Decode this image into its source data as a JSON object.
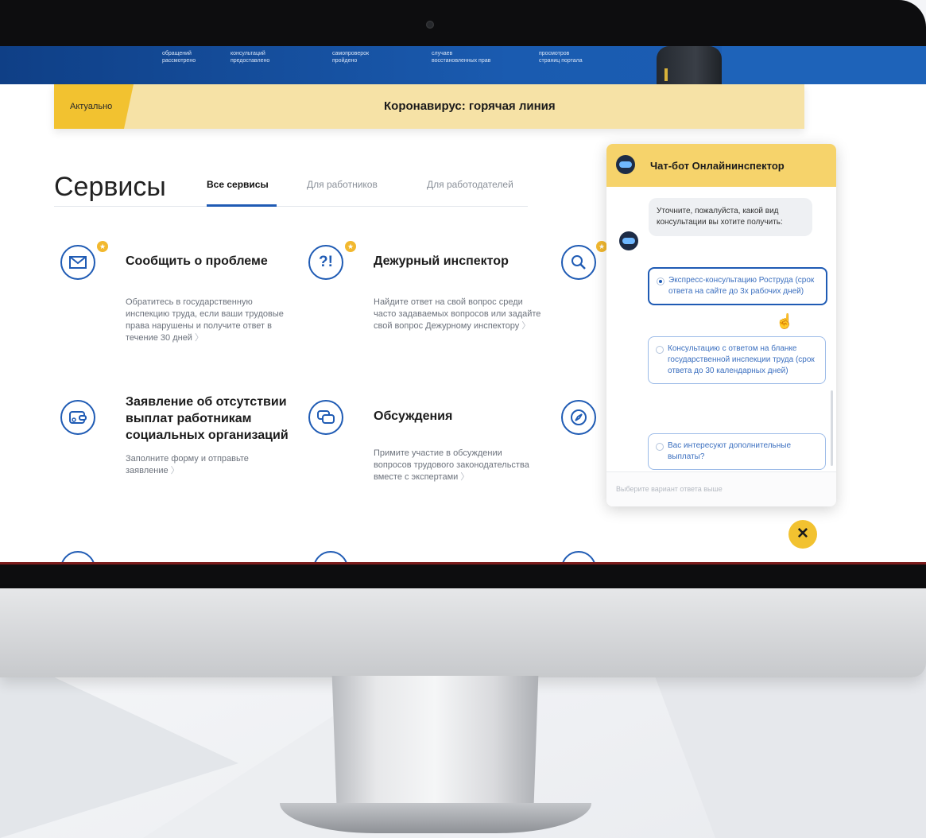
{
  "hero": {
    "stats": [
      {
        "line1": "обращений",
        "line2": "рассмотрено"
      },
      {
        "line1": "консультаций",
        "line2": "предоставлено"
      },
      {
        "line1": "самопроверок",
        "line2": "пройдено"
      },
      {
        "line1": "случаев",
        "line2": "восстановленных прав"
      },
      {
        "line1": "просмотров",
        "line2": "страниц портала"
      }
    ]
  },
  "banner": {
    "tag": "Актуально",
    "title": "Коронавирус: горячая линия"
  },
  "services": {
    "title": "Сервисы",
    "tabs": [
      {
        "label": "Все сервисы"
      },
      {
        "label": "Для работников"
      },
      {
        "label": "Для работодателей"
      }
    ],
    "items": [
      {
        "title": "Сообщить о проблеме",
        "description": "Обратитесь в государственную инспекцию труда, если ваши трудовые права нарушены и получите ответ в течение 30 дней",
        "icon": "envelope-icon"
      },
      {
        "title": "Дежурный инспектор",
        "description": "Найдите ответ на свой вопрос среди часто задаваемых вопросов или задайте свой вопрос Дежурному инспектору",
        "icon": "question-exclamation-icon"
      },
      {
        "title": "Заявление об отсутствии выплат работникам социальных организаций",
        "description": "Заполните форму и отправьте заявление",
        "icon": "wallet-icon"
      },
      {
        "title": "Обсуждения",
        "description": "Примите участие в обсуждении вопросов трудового законодательства вместе с экспертами",
        "icon": "chat-bubbles-icon"
      }
    ]
  },
  "chat": {
    "title": "Чат-бот Онлайнинспектор",
    "bot_message": "Уточните, пожалуйста, какой вид консультации вы хотите получить:",
    "options": [
      {
        "label": "Экспресс-консультацию Роструда (срок ответа на сайте до 3х рабочих дней)",
        "selected": true
      },
      {
        "label": "Консультацию с ответом на бланке государственной инспекции труда (срок ответа до 30 календарных дней)",
        "selected": false
      },
      {
        "label": "Вас интересуют дополнительные выплаты?",
        "selected": false
      }
    ],
    "input_placeholder": "Выберите вариант ответа выше",
    "close_symbol": "✕"
  },
  "colors": {
    "primary_blue": "#1f5bb4",
    "accent_yellow": "#f2c230",
    "banner_yellow": "#f6e2a6"
  }
}
